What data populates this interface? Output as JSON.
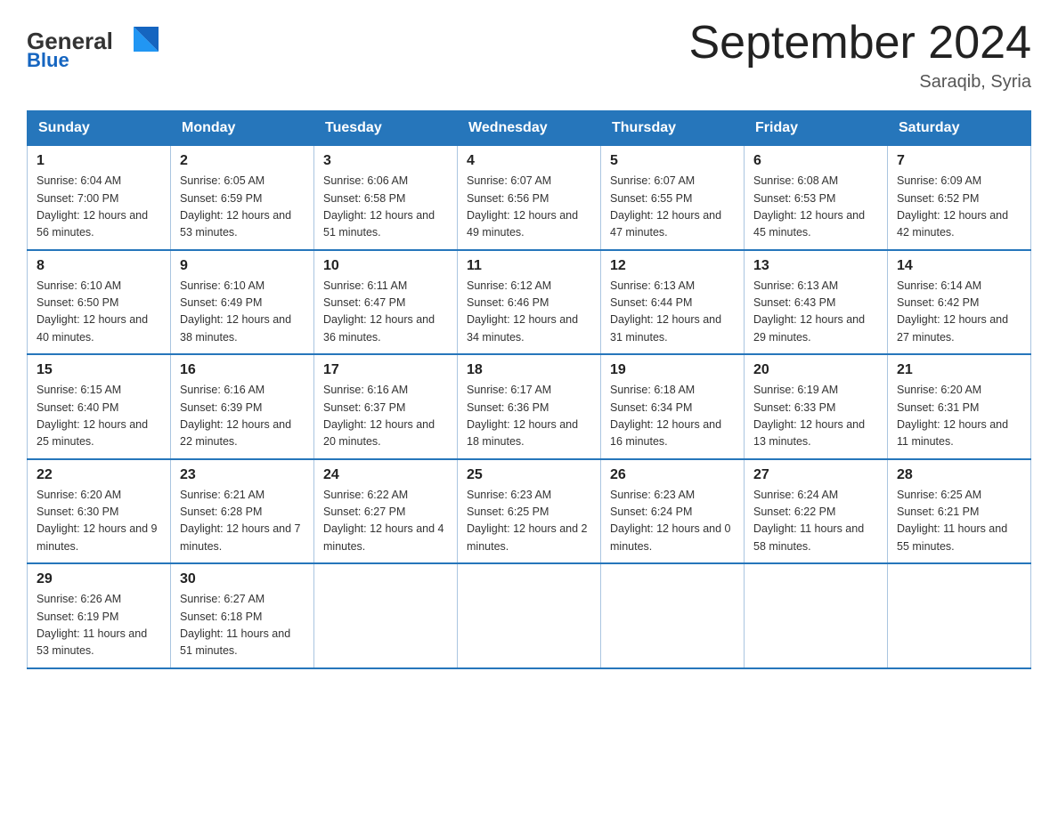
{
  "header": {
    "logo_general": "General",
    "logo_blue": "Blue",
    "title": "September 2024",
    "location": "Saraqib, Syria"
  },
  "days_of_week": [
    "Sunday",
    "Monday",
    "Tuesday",
    "Wednesday",
    "Thursday",
    "Friday",
    "Saturday"
  ],
  "weeks": [
    [
      {
        "day": "1",
        "sunrise": "6:04 AM",
        "sunset": "7:00 PM",
        "daylight": "12 hours and 56 minutes."
      },
      {
        "day": "2",
        "sunrise": "6:05 AM",
        "sunset": "6:59 PM",
        "daylight": "12 hours and 53 minutes."
      },
      {
        "day": "3",
        "sunrise": "6:06 AM",
        "sunset": "6:58 PM",
        "daylight": "12 hours and 51 minutes."
      },
      {
        "day": "4",
        "sunrise": "6:07 AM",
        "sunset": "6:56 PM",
        "daylight": "12 hours and 49 minutes."
      },
      {
        "day": "5",
        "sunrise": "6:07 AM",
        "sunset": "6:55 PM",
        "daylight": "12 hours and 47 minutes."
      },
      {
        "day": "6",
        "sunrise": "6:08 AM",
        "sunset": "6:53 PM",
        "daylight": "12 hours and 45 minutes."
      },
      {
        "day": "7",
        "sunrise": "6:09 AM",
        "sunset": "6:52 PM",
        "daylight": "12 hours and 42 minutes."
      }
    ],
    [
      {
        "day": "8",
        "sunrise": "6:10 AM",
        "sunset": "6:50 PM",
        "daylight": "12 hours and 40 minutes."
      },
      {
        "day": "9",
        "sunrise": "6:10 AM",
        "sunset": "6:49 PM",
        "daylight": "12 hours and 38 minutes."
      },
      {
        "day": "10",
        "sunrise": "6:11 AM",
        "sunset": "6:47 PM",
        "daylight": "12 hours and 36 minutes."
      },
      {
        "day": "11",
        "sunrise": "6:12 AM",
        "sunset": "6:46 PM",
        "daylight": "12 hours and 34 minutes."
      },
      {
        "day": "12",
        "sunrise": "6:13 AM",
        "sunset": "6:44 PM",
        "daylight": "12 hours and 31 minutes."
      },
      {
        "day": "13",
        "sunrise": "6:13 AM",
        "sunset": "6:43 PM",
        "daylight": "12 hours and 29 minutes."
      },
      {
        "day": "14",
        "sunrise": "6:14 AM",
        "sunset": "6:42 PM",
        "daylight": "12 hours and 27 minutes."
      }
    ],
    [
      {
        "day": "15",
        "sunrise": "6:15 AM",
        "sunset": "6:40 PM",
        "daylight": "12 hours and 25 minutes."
      },
      {
        "day": "16",
        "sunrise": "6:16 AM",
        "sunset": "6:39 PM",
        "daylight": "12 hours and 22 minutes."
      },
      {
        "day": "17",
        "sunrise": "6:16 AM",
        "sunset": "6:37 PM",
        "daylight": "12 hours and 20 minutes."
      },
      {
        "day": "18",
        "sunrise": "6:17 AM",
        "sunset": "6:36 PM",
        "daylight": "12 hours and 18 minutes."
      },
      {
        "day": "19",
        "sunrise": "6:18 AM",
        "sunset": "6:34 PM",
        "daylight": "12 hours and 16 minutes."
      },
      {
        "day": "20",
        "sunrise": "6:19 AM",
        "sunset": "6:33 PM",
        "daylight": "12 hours and 13 minutes."
      },
      {
        "day": "21",
        "sunrise": "6:20 AM",
        "sunset": "6:31 PM",
        "daylight": "12 hours and 11 minutes."
      }
    ],
    [
      {
        "day": "22",
        "sunrise": "6:20 AM",
        "sunset": "6:30 PM",
        "daylight": "12 hours and 9 minutes."
      },
      {
        "day": "23",
        "sunrise": "6:21 AM",
        "sunset": "6:28 PM",
        "daylight": "12 hours and 7 minutes."
      },
      {
        "day": "24",
        "sunrise": "6:22 AM",
        "sunset": "6:27 PM",
        "daylight": "12 hours and 4 minutes."
      },
      {
        "day": "25",
        "sunrise": "6:23 AM",
        "sunset": "6:25 PM",
        "daylight": "12 hours and 2 minutes."
      },
      {
        "day": "26",
        "sunrise": "6:23 AM",
        "sunset": "6:24 PM",
        "daylight": "12 hours and 0 minutes."
      },
      {
        "day": "27",
        "sunrise": "6:24 AM",
        "sunset": "6:22 PM",
        "daylight": "11 hours and 58 minutes."
      },
      {
        "day": "28",
        "sunrise": "6:25 AM",
        "sunset": "6:21 PM",
        "daylight": "11 hours and 55 minutes."
      }
    ],
    [
      {
        "day": "29",
        "sunrise": "6:26 AM",
        "sunset": "6:19 PM",
        "daylight": "11 hours and 53 minutes."
      },
      {
        "day": "30",
        "sunrise": "6:27 AM",
        "sunset": "6:18 PM",
        "daylight": "11 hours and 51 minutes."
      },
      null,
      null,
      null,
      null,
      null
    ]
  ]
}
